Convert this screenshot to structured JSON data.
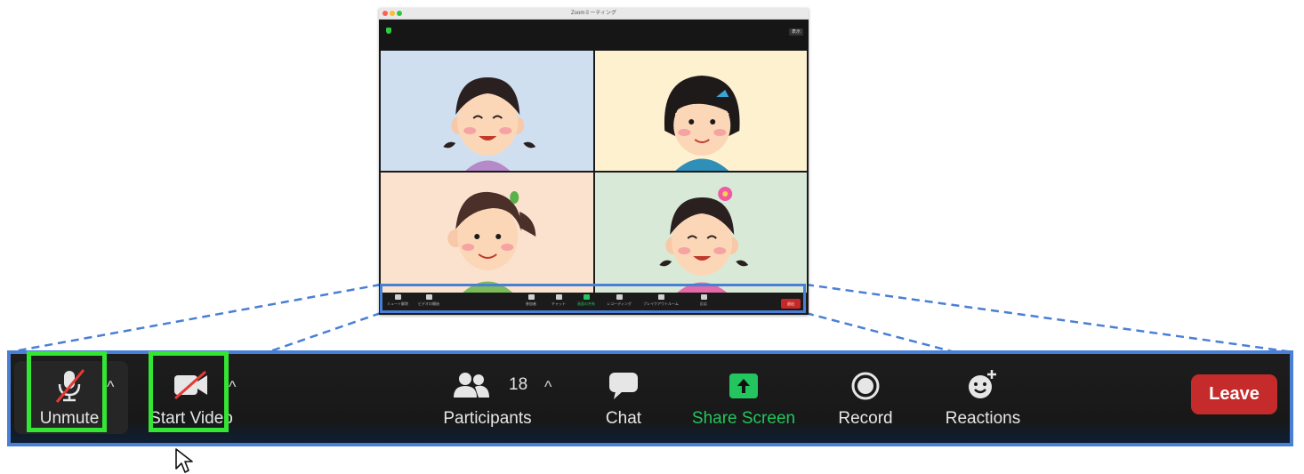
{
  "meeting_window": {
    "title": "Zoomミーティング",
    "view_button": "表示",
    "mini_toolbar": {
      "mute": "ミュート解除",
      "video": "ビデオの開始",
      "participants": "参加者",
      "chat": "チャット",
      "share": "画面の共有",
      "record": "レコーディング",
      "breakout": "ブレイクアウトルーム",
      "reactions": "反応",
      "leave": "退出"
    },
    "tiles": [
      {
        "background": "#cfdff0"
      },
      {
        "background": "#fdf1cf"
      },
      {
        "background": "#fbe2cf"
      },
      {
        "background": "#d8ead7"
      }
    ]
  },
  "toolbar": {
    "unmute_label": "Unmute",
    "start_video_label": "Start Video",
    "participants_label": "Participants",
    "participants_count": "18",
    "chat_label": "Chat",
    "share_screen_label": "Share Screen",
    "record_label": "Record",
    "reactions_label": "Reactions",
    "leave_label": "Leave",
    "caret": "^"
  },
  "colors": {
    "highlight_blue": "#4a7fd6",
    "highlight_green": "#33e633",
    "share_green": "#22c55e",
    "leave_red": "#c62b2b"
  }
}
